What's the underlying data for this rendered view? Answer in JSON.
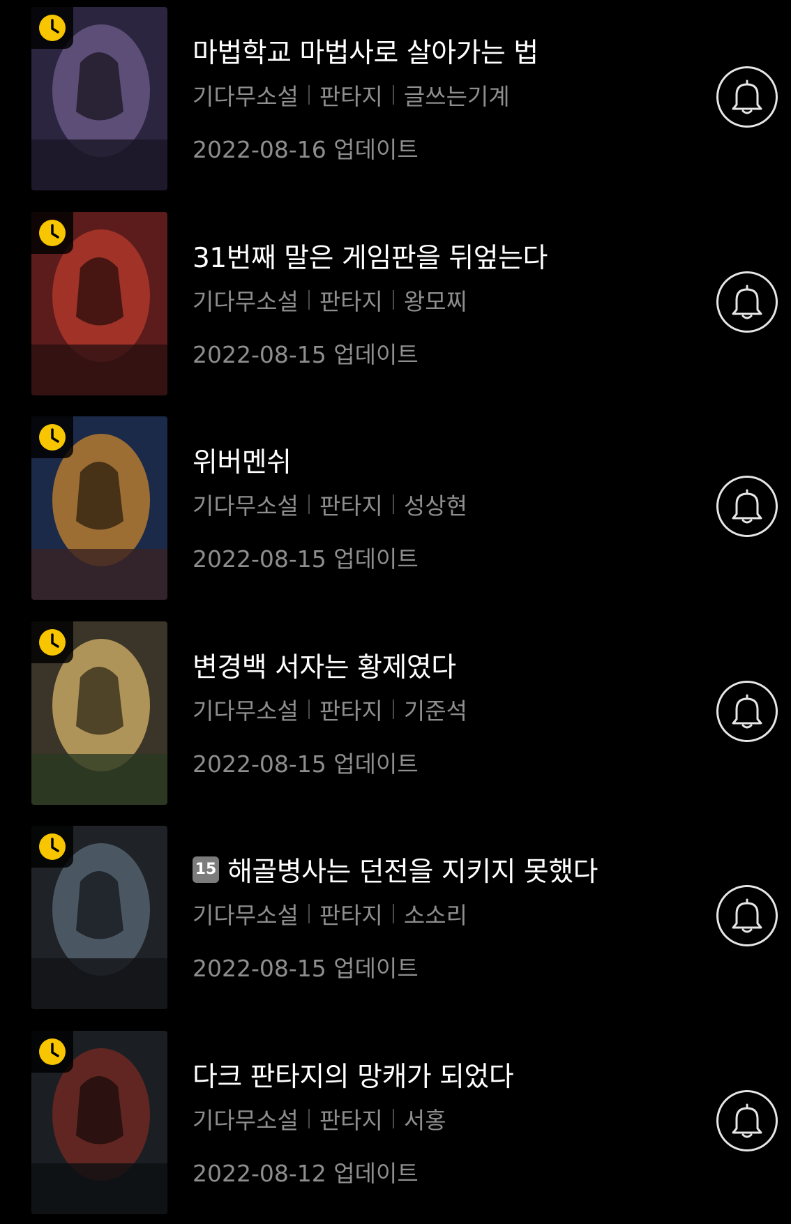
{
  "novels": [
    {
      "title": "마법학교 마법사로 살아가는 법",
      "age_badge": "",
      "category": "기다무소설",
      "genre": "판타지",
      "author": "글쓰는기계",
      "updated": "2022-08-16 업데이트",
      "cover_colors": [
        "#2b2540",
        "#6d5c8a",
        "#1a1626"
      ]
    },
    {
      "title": "31번째 말은 게임판을 뒤엎는다",
      "age_badge": "",
      "category": "기다무소설",
      "genre": "판타지",
      "author": "왕모찌",
      "updated": "2022-08-15 업데이트",
      "cover_colors": [
        "#5c1c1c",
        "#b83a2c",
        "#2b1010"
      ]
    },
    {
      "title": "위버멘쉬",
      "age_badge": "",
      "category": "기다무소설",
      "genre": "판타지",
      "author": "성상현",
      "updated": "2022-08-15 업데이트",
      "cover_colors": [
        "#1c2a4a",
        "#c8862e",
        "#3a2222"
      ]
    },
    {
      "title": "변경백 서자는 황제였다",
      "age_badge": "",
      "category": "기다무소설",
      "genre": "판타지",
      "author": "기준석",
      "updated": "2022-08-15 업데이트",
      "cover_colors": [
        "#3b3428",
        "#d7b46a",
        "#2a3a22"
      ]
    },
    {
      "title": "해골병사는 던전을 지키지 못했다",
      "age_badge": "15",
      "category": "기다무소설",
      "genre": "판타지",
      "author": "소소리",
      "updated": "2022-08-15 업데이트",
      "cover_colors": [
        "#1f2226",
        "#5a6a78",
        "#121417"
      ]
    },
    {
      "title": "다크 판타지의 망캐가 되었다",
      "age_badge": "",
      "category": "기다무소설",
      "genre": "판타지",
      "author": "서홍",
      "updated": "2022-08-12 업데이트",
      "cover_colors": [
        "#1b1f24",
        "#7a2a22",
        "#0d0f12"
      ]
    }
  ],
  "colors": {
    "background": "#000000",
    "title": "#ffffff",
    "meta": "#8e8e8e",
    "clock_badge": "#f7c600",
    "bell": "#e6e6e6",
    "age_badge_bg": "#7c7c7c"
  },
  "icons": {
    "clock": "clock-icon",
    "bell": "bell-icon"
  }
}
